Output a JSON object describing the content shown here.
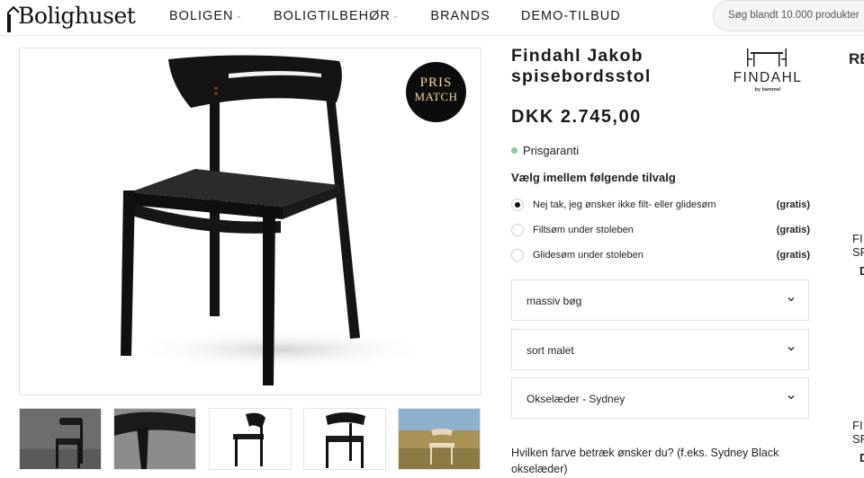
{
  "header": {
    "logo_text": "Bolighuset",
    "nav": [
      {
        "label": "BOLIGEN",
        "has_dropdown": true
      },
      {
        "label": "BOLIGTILBEHØR",
        "has_dropdown": true
      },
      {
        "label": "BRANDS",
        "has_dropdown": false
      },
      {
        "label": "DEMO-TILBUD",
        "has_dropdown": false
      }
    ],
    "search_placeholder": "Søg blandt 10.000 produkter"
  },
  "gallery": {
    "badge": {
      "line1": "PRIS",
      "line2": "MATCH"
    },
    "thumbnails": [
      "chair-dark-studio",
      "backrest-closeup",
      "chair-side-view",
      "chair-front-view",
      "chair-outdoor"
    ]
  },
  "product": {
    "title": "Findahl Jakob spisebordsstol",
    "brand": {
      "name": "FINDAHL",
      "sub": "by hammel"
    },
    "price": "DKK 2.745,00",
    "guarantee": "Prisgaranti",
    "options_heading": "Vælg imellem følgende tilvalg",
    "options": [
      {
        "label": "Nej tak, jeg ønsker ikke filt- eller glidesøm",
        "extra": "(gratis)",
        "selected": true
      },
      {
        "label": "Filtsøm under stoleben",
        "extra": "(gratis)",
        "selected": false
      },
      {
        "label": "Glidesøm under stoleben",
        "extra": "(gratis)",
        "selected": false
      }
    ],
    "selects": [
      {
        "value": "massiv bøg"
      },
      {
        "value": "sort malet"
      },
      {
        "value": "Okselæder - Sydney"
      }
    ],
    "question": "Hvilken farve betræk ønsker du? (f.eks. Sydney Black okselæder)"
  },
  "side": {
    "heading": "RE",
    "item1_line1": "FI",
    "item1_line2": "SF",
    "item1_price": "D",
    "item2_line1": "FI",
    "item2_line2": "SF",
    "item2_price": "D"
  },
  "colors": {
    "accent_dot": "#8bc98f",
    "badge_bg": "#0c0c0c",
    "badge_text": "#f3d99c"
  }
}
